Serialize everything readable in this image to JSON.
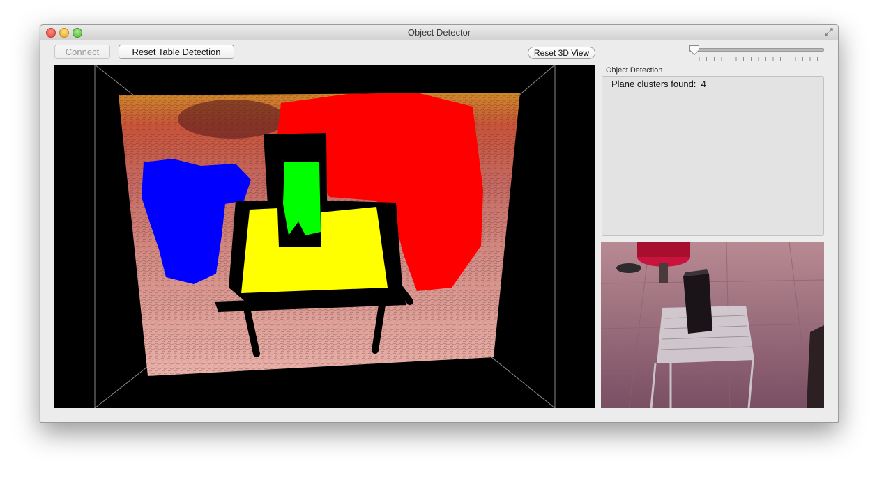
{
  "window": {
    "title": "Object Detector"
  },
  "toolbar": {
    "connect_label": "Connect",
    "reset_table_label": "Reset Table Detection",
    "reset_3d_label": "Reset 3D View"
  },
  "slider": {
    "value": 0
  },
  "detection_panel": {
    "title": "Object Detection",
    "status_label": "Plane clusters found:",
    "status_value": "4"
  },
  "colors": {
    "cluster_red": "#ff0000",
    "cluster_blue": "#0000ff",
    "cluster_green": "#00ff00",
    "cluster_yellow": "#ffff00",
    "background_points": "#e3a09a"
  },
  "icons": [
    "close-icon",
    "minimize-icon",
    "zoom-icon",
    "fullscreen-icon",
    "slider-thumb"
  ]
}
